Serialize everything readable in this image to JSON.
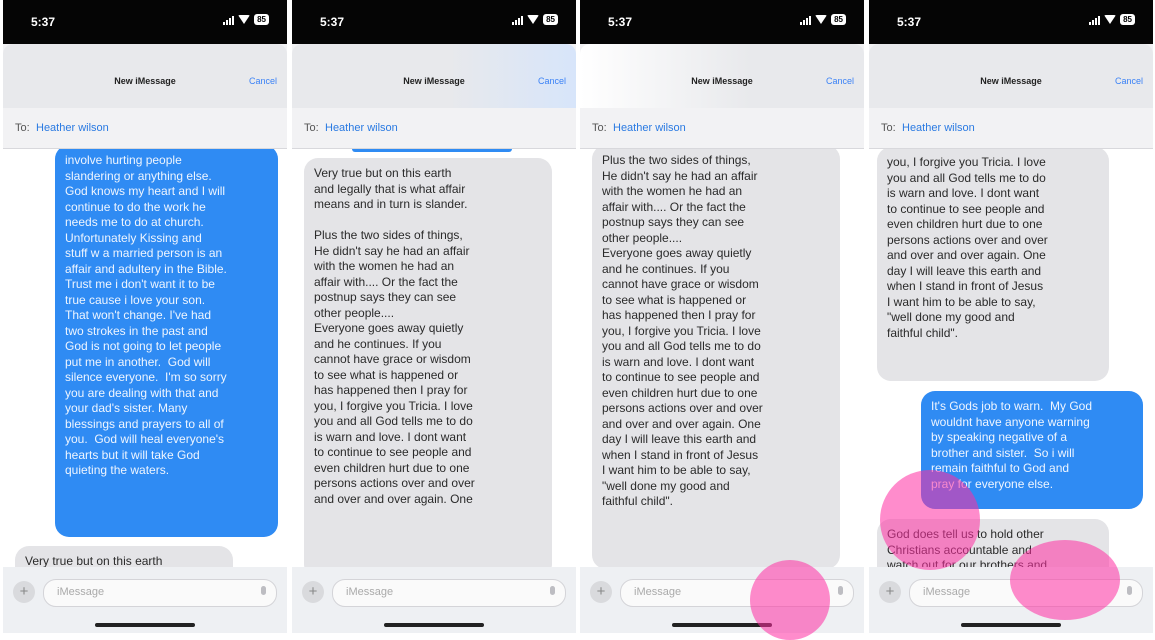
{
  "status_time": "5:37",
  "header": {
    "title": "New iMessage",
    "cancel": "Cancel"
  },
  "to": {
    "label": "To:",
    "name": "Heather wilson"
  },
  "compose": {
    "placeholder": "iMessage"
  },
  "colors": {
    "outgoing": "#2f8bf3",
    "incoming": "#e4e4e7",
    "link": "#2a7ae2"
  },
  "panels": [
    {
      "messages": [
        {
          "dir": "out",
          "text": "involve hurting people\nslandering or anything else.\nGod knows my heart and I will\ncontinue to do the work he\nneeds me to do at church.\nUnfortunately Kissing and\nstuff w a married person is an\naffair and adultery in the Bible.\nTrust me i don't want it to be\ntrue cause i love your son.\nThat won't change. I've had\ntwo strokes in the past and\nGod is not going to let people\nput me in another.  God will\nsilence everyone.  I'm so sorry\nyou are dealing with that and\nyour dad's sister. Many\nblessings and prayers to all of\nyou.  God will heal everyone's\nhearts but it will take God\nquieting the waters."
        },
        {
          "dir": "in",
          "text": "Very true but on this earth"
        }
      ]
    },
    {
      "messages": [
        {
          "dir": "in",
          "text": "Very true but on this earth\nand legally that is what affair\nmeans and in turn is slander.\n\nPlus the two sides of things,\nHe didn't say he had an affair\nwith the women he had an\naffair with.... Or the fact the\npostnup says they can see\nother people....\nEveryone goes away quietly\nand he continues. If you\ncannot have grace or wisdom\nto see what is happened or\nhas happened then I pray for\nyou, I forgive you Tricia. I love\nyou and all God tells me to do\nis warn and love. I dont want\nto continue to see people and\neven children hurt due to one\npersons actions over and over\nand over and over again. One"
        }
      ]
    },
    {
      "messages": [
        {
          "dir": "in",
          "text": "Plus the two sides of things,\nHe didn't say he had an affair\nwith the women he had an\naffair with.... Or the fact the\npostnup says they can see\nother people....\nEveryone goes away quietly\nand he continues. If you\ncannot have grace or wisdom\nto see what is happened or\nhas happened then I pray for\nyou, I forgive you Tricia. I love\nyou and all God tells me to do\nis warn and love. I dont want\nto continue to see people and\neven children hurt due to one\npersons actions over and over\nand over and over again. One\nday I will leave this earth and\nwhen I stand in front of Jesus\nI want him to be able to say,\n\"well done my good and\nfaithful child\"."
        }
      ]
    },
    {
      "messages": [
        {
          "dir": "in",
          "text": "you, I forgive you Tricia. I love\nyou and all God tells me to do\nis warn and love. I dont want\nto continue to see people and\neven children hurt due to one\npersons actions over and over\nand over and over again. One\nday I will leave this earth and\nwhen I stand in front of Jesus\nI want him to be able to say,\n\"well done my good and\nfaithful child\"."
        },
        {
          "dir": "out",
          "text": "It's Gods job to warn.  My God\nwouldnt have anyone warning\nby speaking negative of a\nbrother and sister.  So i will\nremain faithful to God and\npray for everyone else."
        },
        {
          "dir": "in",
          "text": "God does tell us to hold other\nChristians accountable and\nwatch out for our brothers and"
        }
      ]
    }
  ]
}
